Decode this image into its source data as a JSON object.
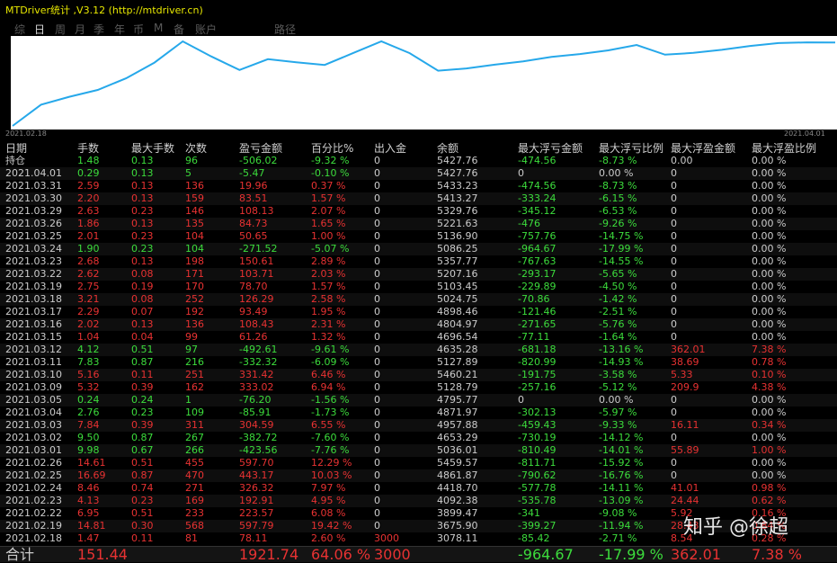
{
  "title": "MTDriver统计 ,V3.12 (http://mtdriver.cn)",
  "tabs": [
    {
      "label": "综",
      "active": false
    },
    {
      "label": "日",
      "active": true
    },
    {
      "label": "周",
      "active": false
    },
    {
      "label": "月",
      "active": false
    },
    {
      "label": "季",
      "active": false
    },
    {
      "label": "年",
      "active": false
    },
    {
      "label": "币",
      "active": false
    },
    {
      "label": "M",
      "active": false
    },
    {
      "label": "备",
      "active": false
    },
    {
      "label": "账户",
      "active": false
    },
    {
      "label": "路径",
      "active": false
    }
  ],
  "chart": {
    "x_start": "2021.02.18",
    "x_end": "2021.04.01",
    "line_color": "#26a8ea",
    "values": [
      3078.11,
      3675.9,
      3899.47,
      4092.38,
      4418.7,
      4861.87,
      5459.61,
      5036.01,
      4653.29,
      4957.88,
      4871.97,
      4795.77,
      5128.79,
      5460.21,
      5127.89,
      4635.28,
      4696.54,
      4804.97,
      4898.46,
      5024.75,
      5103.45,
      5207.16,
      5357.77,
      5086.25,
      5136.9,
      5221.63,
      5329.76,
      5413.27,
      5433.23,
      5427.76
    ]
  },
  "columns": [
    "日期",
    "手数",
    "最大手数",
    "次数",
    "盈亏金额",
    "百分比%",
    "出入金",
    "余额",
    "最大浮亏金额",
    "最大浮亏比例",
    "最大浮盈金额",
    "最大浮盈比例"
  ],
  "rows": [
    {
      "c": [
        "持仓",
        "1.48",
        "0.13",
        "96",
        "-506.02",
        "-9.32 %",
        "0",
        "5427.76",
        "-474.56",
        "-8.73 %",
        "0.00",
        "0.00 %"
      ],
      "k": [
        "w",
        "g",
        "g",
        "g",
        "g",
        "g",
        "w",
        "w",
        "g",
        "g",
        "w",
        "w"
      ]
    },
    {
      "c": [
        "2021.04.01",
        "0.29",
        "0.13",
        "5",
        "-5.47",
        "-0.10 %",
        "0",
        "5427.76",
        "0",
        "0.00 %",
        "0",
        "0.00 %"
      ],
      "k": [
        "w",
        "g",
        "g",
        "g",
        "g",
        "g",
        "w",
        "w",
        "w",
        "w",
        "w",
        "w"
      ]
    },
    {
      "c": [
        "2021.03.31",
        "2.59",
        "0.13",
        "136",
        "19.96",
        "0.37 %",
        "0",
        "5433.23",
        "-474.56",
        "-8.73 %",
        "0",
        "0.00 %"
      ],
      "k": [
        "w",
        "r",
        "r",
        "r",
        "r",
        "r",
        "w",
        "w",
        "g",
        "g",
        "w",
        "w"
      ]
    },
    {
      "c": [
        "2021.03.30",
        "2.20",
        "0.13",
        "159",
        "83.51",
        "1.57 %",
        "0",
        "5413.27",
        "-333.24",
        "-6.15 %",
        "0",
        "0.00 %"
      ],
      "k": [
        "w",
        "r",
        "r",
        "r",
        "r",
        "r",
        "w",
        "w",
        "g",
        "g",
        "w",
        "w"
      ]
    },
    {
      "c": [
        "2021.03.29",
        "2.63",
        "0.23",
        "146",
        "108.13",
        "2.07 %",
        "0",
        "5329.76",
        "-345.12",
        "-6.53 %",
        "0",
        "0.00 %"
      ],
      "k": [
        "w",
        "r",
        "r",
        "r",
        "r",
        "r",
        "w",
        "w",
        "g",
        "g",
        "w",
        "w"
      ]
    },
    {
      "c": [
        "2021.03.26",
        "1.86",
        "0.13",
        "135",
        "84.73",
        "1.65 %",
        "0",
        "5221.63",
        "-476",
        "-9.26 %",
        "0",
        "0.00 %"
      ],
      "k": [
        "w",
        "r",
        "r",
        "r",
        "r",
        "r",
        "w",
        "w",
        "g",
        "g",
        "w",
        "w"
      ]
    },
    {
      "c": [
        "2021.03.25",
        "2.01",
        "0.23",
        "104",
        "50.65",
        "1.00 %",
        "0",
        "5136.90",
        "-757.76",
        "-14.75 %",
        "0",
        "0.00 %"
      ],
      "k": [
        "w",
        "r",
        "r",
        "r",
        "r",
        "r",
        "w",
        "w",
        "g",
        "g",
        "w",
        "w"
      ]
    },
    {
      "c": [
        "2021.03.24",
        "1.90",
        "0.23",
        "104",
        "-271.52",
        "-5.07 %",
        "0",
        "5086.25",
        "-964.67",
        "-17.99 %",
        "0",
        "0.00 %"
      ],
      "k": [
        "w",
        "g",
        "g",
        "g",
        "g",
        "g",
        "w",
        "w",
        "g",
        "g",
        "w",
        "w"
      ]
    },
    {
      "c": [
        "2021.03.23",
        "2.68",
        "0.13",
        "198",
        "150.61",
        "2.89 %",
        "0",
        "5357.77",
        "-767.63",
        "-14.55 %",
        "0",
        "0.00 %"
      ],
      "k": [
        "w",
        "r",
        "r",
        "r",
        "r",
        "r",
        "w",
        "w",
        "g",
        "g",
        "w",
        "w"
      ]
    },
    {
      "c": [
        "2021.03.22",
        "2.62",
        "0.08",
        "171",
        "103.71",
        "2.03 %",
        "0",
        "5207.16",
        "-293.17",
        "-5.65 %",
        "0",
        "0.00 %"
      ],
      "k": [
        "w",
        "r",
        "r",
        "r",
        "r",
        "r",
        "w",
        "w",
        "g",
        "g",
        "w",
        "w"
      ]
    },
    {
      "c": [
        "2021.03.19",
        "2.75",
        "0.19",
        "170",
        "78.70",
        "1.57 %",
        "0",
        "5103.45",
        "-229.89",
        "-4.50 %",
        "0",
        "0.00 %"
      ],
      "k": [
        "w",
        "r",
        "r",
        "r",
        "r",
        "r",
        "w",
        "w",
        "g",
        "g",
        "w",
        "w"
      ]
    },
    {
      "c": [
        "2021.03.18",
        "3.21",
        "0.08",
        "252",
        "126.29",
        "2.58 %",
        "0",
        "5024.75",
        "-70.86",
        "-1.42 %",
        "0",
        "0.00 %"
      ],
      "k": [
        "w",
        "r",
        "r",
        "r",
        "r",
        "r",
        "w",
        "w",
        "g",
        "g",
        "w",
        "w"
      ]
    },
    {
      "c": [
        "2021.03.17",
        "2.29",
        "0.07",
        "192",
        "93.49",
        "1.95 %",
        "0",
        "4898.46",
        "-121.46",
        "-2.51 %",
        "0",
        "0.00 %"
      ],
      "k": [
        "w",
        "r",
        "r",
        "r",
        "r",
        "r",
        "w",
        "w",
        "g",
        "g",
        "w",
        "w"
      ]
    },
    {
      "c": [
        "2021.03.16",
        "2.02",
        "0.13",
        "136",
        "108.43",
        "2.31 %",
        "0",
        "4804.97",
        "-271.65",
        "-5.76 %",
        "0",
        "0.00 %"
      ],
      "k": [
        "w",
        "r",
        "r",
        "r",
        "r",
        "r",
        "w",
        "w",
        "g",
        "g",
        "w",
        "w"
      ]
    },
    {
      "c": [
        "2021.03.15",
        "1.04",
        "0.04",
        "99",
        "61.26",
        "1.32 %",
        "0",
        "4696.54",
        "-77.11",
        "-1.64 %",
        "0",
        "0.00 %"
      ],
      "k": [
        "w",
        "r",
        "r",
        "r",
        "r",
        "r",
        "w",
        "w",
        "g",
        "g",
        "w",
        "w"
      ]
    },
    {
      "c": [
        "2021.03.12",
        "4.12",
        "0.51",
        "97",
        "-492.61",
        "-9.61 %",
        "0",
        "4635.28",
        "-681.18",
        "-13.16 %",
        "362.01",
        "7.38 %"
      ],
      "k": [
        "w",
        "g",
        "g",
        "g",
        "g",
        "g",
        "w",
        "w",
        "g",
        "g",
        "r",
        "r"
      ]
    },
    {
      "c": [
        "2021.03.11",
        "7.83",
        "0.87",
        "216",
        "-332.32",
        "-6.09 %",
        "0",
        "5127.89",
        "-820.99",
        "-14.93 %",
        "38.69",
        "0.78 %"
      ],
      "k": [
        "w",
        "g",
        "g",
        "g",
        "g",
        "g",
        "w",
        "w",
        "g",
        "g",
        "r",
        "r"
      ]
    },
    {
      "c": [
        "2021.03.10",
        "5.16",
        "0.11",
        "251",
        "331.42",
        "6.46 %",
        "0",
        "5460.21",
        "-191.75",
        "-3.58 %",
        "5.33",
        "0.10 %"
      ],
      "k": [
        "w",
        "r",
        "r",
        "r",
        "r",
        "r",
        "w",
        "w",
        "g",
        "g",
        "r",
        "r"
      ]
    },
    {
      "c": [
        "2021.03.09",
        "5.32",
        "0.39",
        "162",
        "333.02",
        "6.94 %",
        "0",
        "5128.79",
        "-257.16",
        "-5.12 %",
        "209.9",
        "4.38 %"
      ],
      "k": [
        "w",
        "r",
        "r",
        "r",
        "r",
        "r",
        "w",
        "w",
        "g",
        "g",
        "r",
        "r"
      ]
    },
    {
      "c": [
        "2021.03.05",
        "0.24",
        "0.24",
        "1",
        "-76.20",
        "-1.56 %",
        "0",
        "4795.77",
        "0",
        "0.00 %",
        "0",
        "0.00 %"
      ],
      "k": [
        "w",
        "g",
        "g",
        "g",
        "g",
        "g",
        "w",
        "w",
        "w",
        "w",
        "w",
        "w"
      ]
    },
    {
      "c": [
        "2021.03.04",
        "2.76",
        "0.23",
        "109",
        "-85.91",
        "-1.73 %",
        "0",
        "4871.97",
        "-302.13",
        "-5.97 %",
        "0",
        "0.00 %"
      ],
      "k": [
        "w",
        "g",
        "g",
        "g",
        "g",
        "g",
        "w",
        "w",
        "g",
        "g",
        "w",
        "w"
      ]
    },
    {
      "c": [
        "2021.03.03",
        "7.84",
        "0.39",
        "311",
        "304.59",
        "6.55 %",
        "0",
        "4957.88",
        "-459.43",
        "-9.33 %",
        "16.11",
        "0.34 %"
      ],
      "k": [
        "w",
        "r",
        "r",
        "r",
        "r",
        "r",
        "w",
        "w",
        "g",
        "g",
        "r",
        "r"
      ]
    },
    {
      "c": [
        "2021.03.02",
        "9.50",
        "0.87",
        "267",
        "-382.72",
        "-7.60 %",
        "0",
        "4653.29",
        "-730.19",
        "-14.12 %",
        "0",
        "0.00 %"
      ],
      "k": [
        "w",
        "g",
        "g",
        "g",
        "g",
        "g",
        "w",
        "w",
        "g",
        "g",
        "w",
        "w"
      ]
    },
    {
      "c": [
        "2021.03.01",
        "9.98",
        "0.67",
        "266",
        "-423.56",
        "-7.76 %",
        "0",
        "5036.01",
        "-810.49",
        "-14.01 %",
        "55.89",
        "1.00 %"
      ],
      "k": [
        "w",
        "g",
        "g",
        "g",
        "g",
        "g",
        "w",
        "w",
        "g",
        "g",
        "r",
        "r"
      ]
    },
    {
      "c": [
        "2021.02.26",
        "14.61",
        "0.51",
        "455",
        "597.70",
        "12.29 %",
        "0",
        "5459.57",
        "-811.71",
        "-15.92 %",
        "0",
        "0.00 %"
      ],
      "k": [
        "w",
        "r",
        "r",
        "r",
        "r",
        "r",
        "w",
        "w",
        "g",
        "g",
        "w",
        "w"
      ]
    },
    {
      "c": [
        "2021.02.25",
        "16.69",
        "0.87",
        "470",
        "443.17",
        "10.03 %",
        "0",
        "4861.87",
        "-790.62",
        "-16.76 %",
        "0",
        "0.00 %"
      ],
      "k": [
        "w",
        "r",
        "r",
        "r",
        "r",
        "r",
        "w",
        "w",
        "g",
        "g",
        "w",
        "w"
      ]
    },
    {
      "c": [
        "2021.02.24",
        "8.46",
        "0.74",
        "271",
        "326.32",
        "7.97 %",
        "0",
        "4418.70",
        "-577.78",
        "-14.11 %",
        "41.01",
        "0.98 %"
      ],
      "k": [
        "w",
        "r",
        "r",
        "r",
        "r",
        "r",
        "w",
        "w",
        "g",
        "g",
        "r",
        "r"
      ]
    },
    {
      "c": [
        "2021.02.23",
        "4.13",
        "0.23",
        "169",
        "192.91",
        "4.95 %",
        "0",
        "4092.38",
        "-535.78",
        "-13.09 %",
        "24.44",
        "0.62 %"
      ],
      "k": [
        "w",
        "r",
        "r",
        "r",
        "r",
        "r",
        "w",
        "w",
        "g",
        "g",
        "r",
        "r"
      ]
    },
    {
      "c": [
        "2021.02.22",
        "6.95",
        "0.51",
        "233",
        "223.57",
        "6.08 %",
        "0",
        "3899.47",
        "-341",
        "-9.08 %",
        "5.92",
        "0.16 %"
      ],
      "k": [
        "w",
        "r",
        "r",
        "r",
        "r",
        "r",
        "w",
        "w",
        "g",
        "g",
        "r",
        "r"
      ]
    },
    {
      "c": [
        "2021.02.19",
        "14.81",
        "0.30",
        "568",
        "597.79",
        "19.42 %",
        "0",
        "3675.90",
        "-399.27",
        "-11.94 %",
        "28.43",
        "0.84 %"
      ],
      "k": [
        "w",
        "r",
        "r",
        "r",
        "r",
        "r",
        "w",
        "w",
        "g",
        "g",
        "r",
        "r"
      ]
    },
    {
      "c": [
        "2021.02.18",
        "1.47",
        "0.11",
        "81",
        "78.11",
        "2.60 %",
        "3000",
        "3078.11",
        "-85.42",
        "-2.71 %",
        "8.54",
        "0.28 %"
      ],
      "k": [
        "w",
        "r",
        "r",
        "r",
        "r",
        "r",
        "r",
        "w",
        "g",
        "g",
        "r",
        "r"
      ]
    }
  ],
  "total": {
    "c": [
      "合计",
      "151.44",
      "",
      "",
      "1921.74",
      "64.06 %",
      "3000",
      "",
      "-964.67",
      "-17.99 %",
      "362.01",
      "7.38 %"
    ],
    "k": [
      "w",
      "r",
      "w",
      "w",
      "r",
      "r",
      "r",
      "w",
      "g",
      "g",
      "r",
      "r"
    ]
  },
  "watermark": "知乎 @徐超"
}
